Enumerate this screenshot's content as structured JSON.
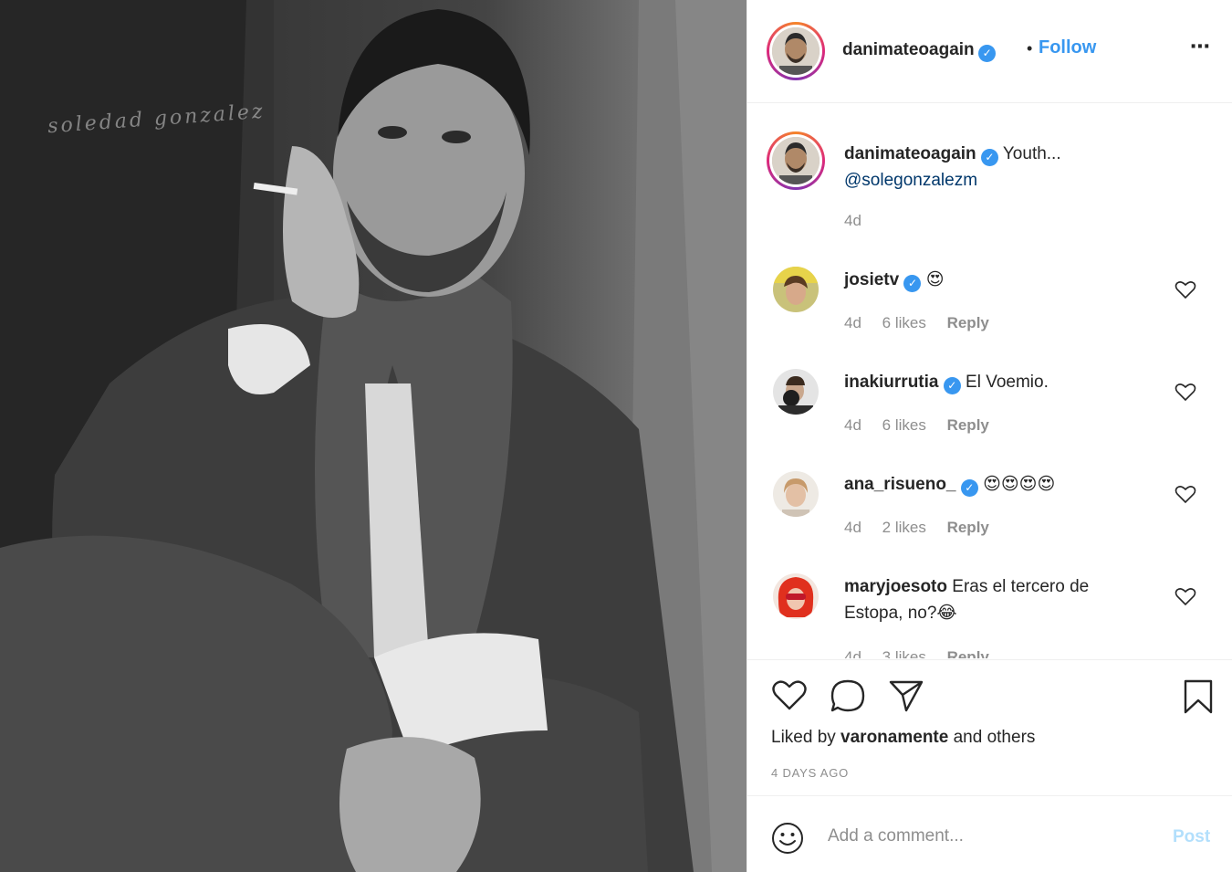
{
  "post": {
    "watermark": "soledad gonzalez",
    "author": "danimateoagain",
    "separator": "•",
    "follow_label": "Follow",
    "more_icon": "⋯",
    "caption": {
      "username": "danimateoagain",
      "text": "Youth...",
      "mention": "@solegonzalezm",
      "time": "4d"
    },
    "comments": [
      {
        "username": "josietv",
        "verified": true,
        "text": "😍",
        "time": "4d",
        "likes": "6 likes",
        "reply": "Reply"
      },
      {
        "username": "inakiurrutia",
        "verified": true,
        "text": "El Voemio.",
        "time": "4d",
        "likes": "6 likes",
        "reply": "Reply"
      },
      {
        "username": "ana_risueno_",
        "verified": true,
        "text": "😍😍😍😍",
        "time": "4d",
        "likes": "2 likes",
        "reply": "Reply"
      },
      {
        "username": "maryjoesoto",
        "verified": false,
        "text": "Eras el tercero de Estopa, no?😂",
        "time": "4d",
        "likes": "3 likes",
        "reply": "Reply"
      }
    ],
    "liked_by": {
      "prefix": "Liked by ",
      "user": "varonamente",
      "suffix": " and others"
    },
    "date": "4 DAYS AGO",
    "comment_placeholder": "Add a comment...",
    "post_label": "Post",
    "colors": {
      "link": "#3897f0",
      "mention": "#00376b",
      "muted": "#8e8e8e",
      "post_disabled": "#b2dffc"
    }
  }
}
